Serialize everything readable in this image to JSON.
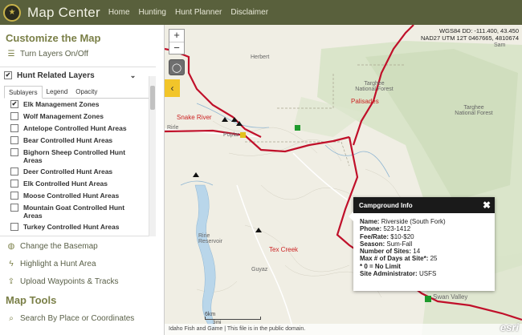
{
  "header": {
    "title": "Map Center",
    "logo_icon": "badge-icon",
    "nav": [
      "Home",
      "Hunting",
      "Hunt Planner",
      "Disclaimer"
    ],
    "bg_color": "#59603c"
  },
  "sidebar": {
    "customize_title": "Customize the Map",
    "turn_layers": "Turn Layers On/Off",
    "layer_group": {
      "label": "Hunt Related Layers",
      "checked": true,
      "tabs": [
        "Sublayers",
        "Legend",
        "Opacity"
      ],
      "active_tab": "Sublayers",
      "sublayers": [
        {
          "label": "Elk Management Zones",
          "checked": true
        },
        {
          "label": "Wolf Management Zones",
          "checked": false
        },
        {
          "label": "Antelope Controlled Hunt Areas",
          "checked": false
        },
        {
          "label": "Bear Controlled Hunt Areas",
          "checked": false
        },
        {
          "label": "Bighorn Sheep Controlled Hunt Areas",
          "checked": false
        },
        {
          "label": "Deer Controlled Hunt Areas",
          "checked": false
        },
        {
          "label": "Elk Controlled Hunt Areas",
          "checked": false
        },
        {
          "label": "Moose Controlled Hunt Areas",
          "checked": false
        },
        {
          "label": "Mountain Goat Controlled Hunt Areas",
          "checked": false
        },
        {
          "label": "Turkey Controlled Hunt Areas",
          "checked": false
        }
      ]
    },
    "links": [
      {
        "label": "Change the Basemap",
        "icon": "globe-icon"
      },
      {
        "label": "Highlight a Hunt Area",
        "icon": "bolt-icon"
      },
      {
        "label": "Upload Waypoints & Tracks",
        "icon": "upload-icon"
      }
    ],
    "tools_title": "Map Tools",
    "tools": [
      {
        "label": "Search By Place or Coordinates",
        "icon": "search-icon"
      }
    ]
  },
  "map": {
    "coords_line1": "WGS84 DD: -111.400, 43.450",
    "coords_line2": "NAD27 UTM 12T 0467665, 4810674",
    "labels": [
      "Herbert",
      "Snake River",
      "Rirle",
      "Poplar",
      "Palisades",
      "Targhee National Forest",
      "Targhee National Forest",
      "Tex Creek",
      "Guyaz",
      "Ririe Reservoir",
      "Swan Valley",
      "Sam"
    ],
    "scale_km": "6km",
    "scale_mi": "3mi",
    "attribution": "Idaho Fish and Game | This file is in the public domain.",
    "esri": "esri"
  },
  "popup": {
    "title": "Campground Info",
    "rows": [
      {
        "k": "Name:",
        "v": "Riverside (South Fork)"
      },
      {
        "k": "Phone:",
        "v": "523-1412"
      },
      {
        "k": "Fee/Rate:",
        "v": "$10-$20"
      },
      {
        "k": "Season:",
        "v": "Sum-Fall"
      },
      {
        "k": "Number of Sites:",
        "v": "14"
      },
      {
        "k": "Max # of Days at Site*:",
        "v": "25"
      },
      {
        "k": "* 0 = No Limit",
        "v": ""
      },
      {
        "k": "Site Administrator:",
        "v": "USFS"
      }
    ]
  },
  "colors": {
    "accent": "#7a7f47",
    "route": "#c0102a",
    "popup_head": "#1a1a1a",
    "collapse": "#f2c52a"
  }
}
